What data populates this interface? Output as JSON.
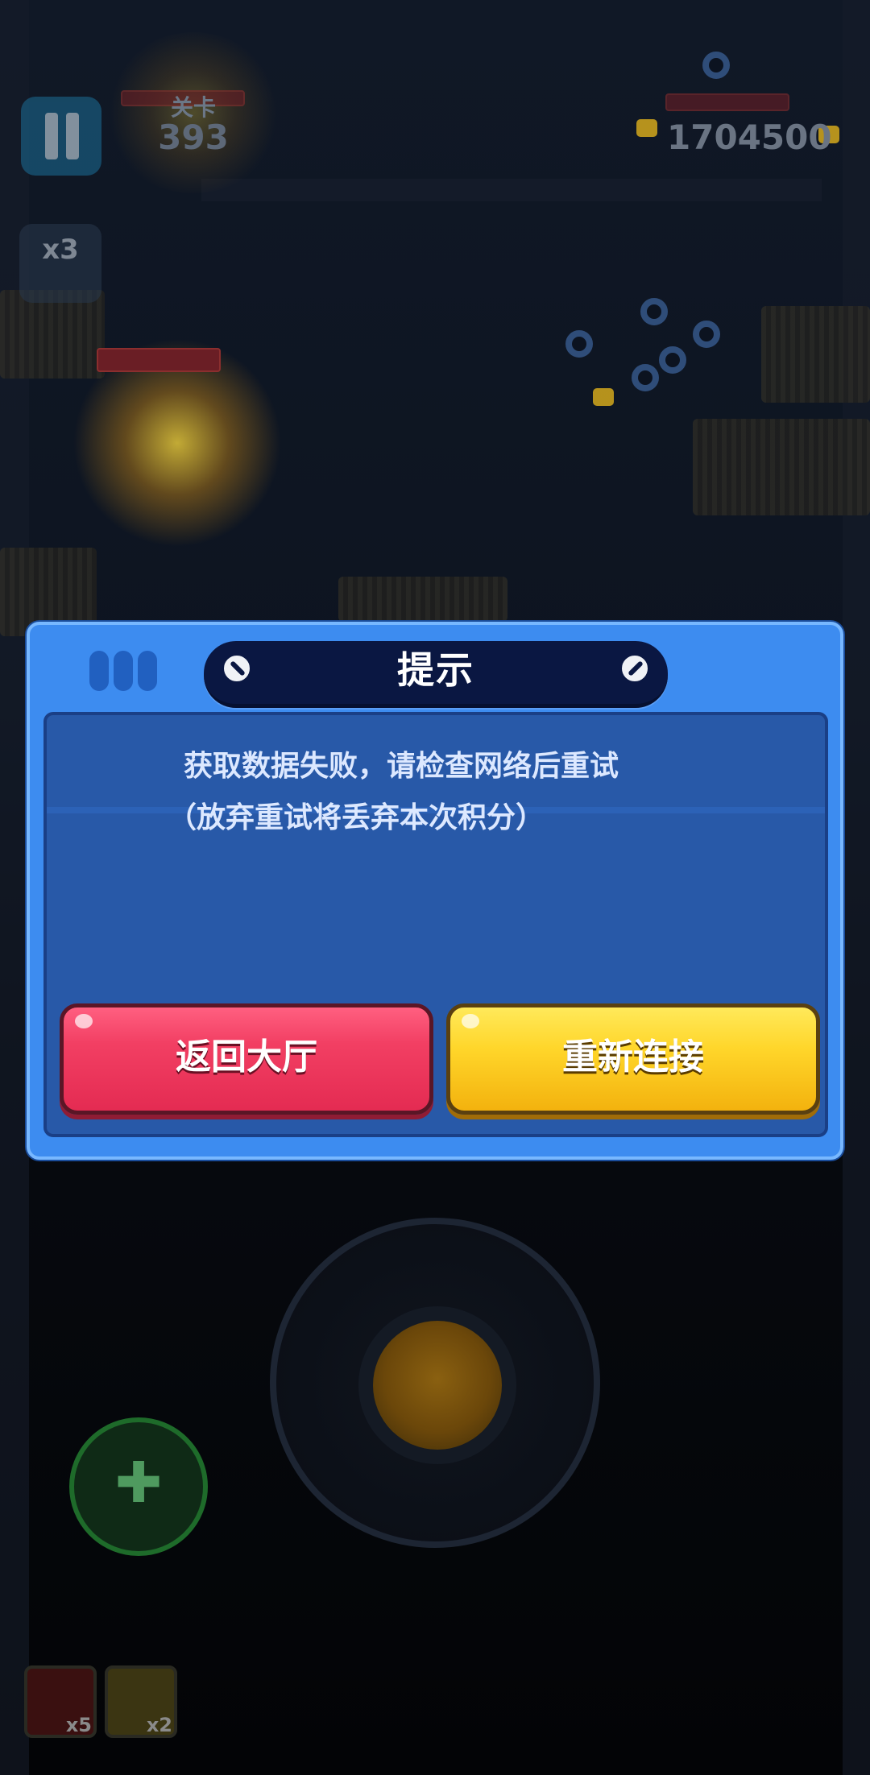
{
  "hud": {
    "level_label": "关卡",
    "level_value": "393",
    "score": "1704500",
    "multiplier": "x3"
  },
  "dialog": {
    "title": "提示",
    "message_line1": "获取数据失败，请检查网络后重试",
    "message_line2": "（放弃重试将丢弃本次积分）",
    "buttons": {
      "back_label": "返回大厅",
      "reconnect_label": "重新连接"
    }
  },
  "inventory": [
    {
      "icon": "sword-item-icon",
      "count": "x5"
    },
    {
      "icon": "shield-item-icon",
      "count": "x2"
    }
  ],
  "colors": {
    "dialog_bg": "#3d8cf0",
    "title_bar": "#0a1742",
    "back_button": "#f23f63",
    "reconnect_button": "#ffd62a"
  }
}
